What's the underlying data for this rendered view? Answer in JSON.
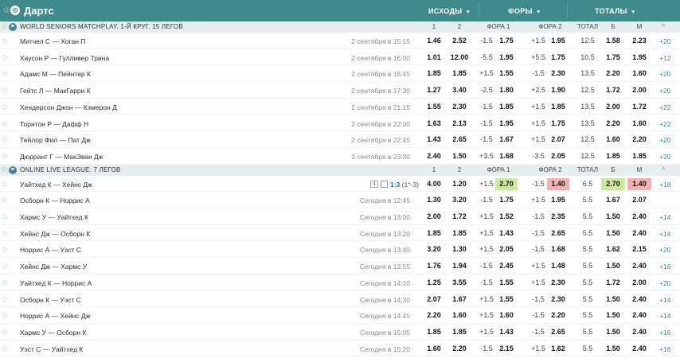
{
  "header": {
    "title": "Дартс",
    "groups": [
      "ИСХОДЫ",
      "ФОРЫ",
      "ТОТАЛЫ"
    ]
  },
  "leagues": [
    {
      "name": "WORLD SENIORS MATCHPLAY. 1-Й КРУГ. 15 ЛЕГОВ",
      "cols": [
        "1",
        "2",
        "ФОРА 1",
        "ФОРА 2",
        "ТОТАЛ",
        "Б",
        "М"
      ],
      "matches": [
        {
          "name": "Митчел С — Хоган П",
          "time": "2 сентября в 15:15",
          "o1": "1.46",
          "o2": "2.52",
          "h1": "-1.5",
          "h1o": "1.75",
          "h2": "+1.5",
          "h2o": "1.95",
          "t": "12.5",
          "b": "1.58",
          "m": "2.23",
          "more": "+20"
        },
        {
          "name": "Хаусон Р — Гулливер Трина",
          "time": "2 сентября в 16:00",
          "o1": "1.01",
          "o2": "12.00",
          "h1": "-5.5",
          "h1o": "1.95",
          "h2": "+5.5",
          "h2o": "1.75",
          "t": "10.5",
          "b": "1.75",
          "m": "1.95",
          "more": "+12"
        },
        {
          "name": "Адамс М — Пейнтер К",
          "time": "2 сентября в 16:45",
          "o1": "1.85",
          "o2": "1.85",
          "h1": "+1.5",
          "h1o": "1.55",
          "h2": "-1.5",
          "h2o": "2.30",
          "t": "13.5",
          "b": "2.20",
          "m": "1.60",
          "more": "+20"
        },
        {
          "name": "Гейтс Л — МакГарри К",
          "time": "2 сентября в 17:30",
          "o1": "1.27",
          "o2": "3.40",
          "h1": "-2.5",
          "h1o": "1.80",
          "h2": "+2.5",
          "h2o": "1.90",
          "t": "12.5",
          "b": "1.72",
          "m": "2.00",
          "more": "+20"
        },
        {
          "name": "Хендерсон Джон — Кэмерон Д",
          "time": "2 сентября в 21:15",
          "o1": "1.55",
          "o2": "2.30",
          "h1": "-1.5",
          "h1o": "1.85",
          "h2": "+1.5",
          "h2o": "1.85",
          "t": "13.5",
          "b": "2.00",
          "m": "1.72",
          "more": "+22"
        },
        {
          "name": "Торнтон Р — Дафф Н",
          "time": "2 сентября в 22:00",
          "o1": "1.63",
          "o2": "2.13",
          "h1": "-1.5",
          "h1o": "1.95",
          "h2": "+1.5",
          "h2o": "1.75",
          "t": "13.5",
          "b": "2.20",
          "m": "1.60",
          "more": "+22"
        },
        {
          "name": "Тейлор Фил — Пат Дж",
          "time": "2 сентября в 22:45",
          "o1": "1.43",
          "o2": "2.65",
          "h1": "-1.5",
          "h1o": "1.67",
          "h2": "+1.5",
          "h2o": "2.07",
          "t": "12.5",
          "b": "1.60",
          "m": "2.20",
          "more": "+20"
        },
        {
          "name": "Дюррант Г — МакЭван Дж",
          "time": "2 сентября в 23:30",
          "o1": "2.40",
          "o2": "1.50",
          "h1": "+3.5",
          "h1o": "1.68",
          "h2": "-3.5",
          "h2o": "2.05",
          "t": "12.5",
          "b": "1.85",
          "m": "1.85",
          "more": "+20"
        }
      ]
    },
    {
      "name": "ONLINE LIVE LEAGUE. 7 ЛЕГОВ",
      "cols": [
        "1",
        "2",
        "ФОРА 1",
        "ФОРА 2",
        "ТОТАЛ",
        "Б",
        "М"
      ],
      "matches": [
        {
          "name": "Уайтхед К — Хейнс Дж",
          "time": "",
          "live": "4",
          "score": "1:3",
          "score_detail": "(1*-3)",
          "o1": "4.00",
          "o2": "1.20",
          "h1": "+1.5",
          "h1o": "2.70",
          "h2": "-1.5",
          "h2o": "1.40",
          "t": "6.5",
          "b": "2.70",
          "m": "1.40",
          "more": "+18"
        },
        {
          "name": "Осборн К — Норрис А",
          "time": "Сегодня в 12:45",
          "o1": "1.30",
          "o2": "3.20",
          "h1": "-1.5",
          "h1o": "1.75",
          "h2": "+1.5",
          "h2o": "1.95",
          "t": "5.5",
          "b": "1.67",
          "m": "2.07",
          "more": ""
        },
        {
          "name": "Хармс У — Уайтхед К",
          "time": "Сегодня в 13:00",
          "o1": "2.00",
          "o2": "1.72",
          "h1": "+1.5",
          "h1o": "1.52",
          "h2": "-1.5",
          "h2o": "2.35",
          "t": "5.5",
          "b": "1.50",
          "m": "2.40",
          "more": "+14"
        },
        {
          "name": "Хейнс Дж — Осборн К",
          "time": "Сегодня в 13:20",
          "o1": "1.85",
          "o2": "1.85",
          "h1": "+1.5",
          "h1o": "1.43",
          "h2": "-1.5",
          "h2o": "2.65",
          "t": "5.5",
          "b": "1.50",
          "m": "2.40",
          "more": "+14"
        },
        {
          "name": "Норрис А — Уэст С",
          "time": "Сегодня в 13:40",
          "o1": "3.20",
          "o2": "1.30",
          "h1": "+1.5",
          "h1o": "2.05",
          "h2": "-1.5",
          "h2o": "1.68",
          "t": "5.5",
          "b": "1.62",
          "m": "2.15",
          "more": "+20"
        },
        {
          "name": "Хейнс Дж — Хармс У",
          "time": "Сегодня в 13:55",
          "o1": "1.76",
          "o2": "1.94",
          "h1": "-1.5",
          "h1o": "2.45",
          "h2": "+1.5",
          "h2o": "1.48",
          "t": "5.5",
          "b": "1.50",
          "m": "2.40",
          "more": "+16"
        },
        {
          "name": "Уайтхед К — Норрис А",
          "time": "Сегодня в 14:10",
          "o1": "1.25",
          "o2": "3.55",
          "h1": "-1.5",
          "h1o": "1.55",
          "h2": "+1.5",
          "h2o": "2.30",
          "t": "5.5",
          "b": "1.72",
          "m": "2.00",
          "more": "+20"
        },
        {
          "name": "Осборн К — Уэст С",
          "time": "Сегодня в 14:30",
          "o1": "2.07",
          "o2": "1.67",
          "h1": "+1.5",
          "h1o": "1.55",
          "h2": "-1.5",
          "h2o": "2.30",
          "t": "5.5",
          "b": "1.50",
          "m": "2.40",
          "more": "+14"
        },
        {
          "name": "Норрис А — Хейнс Дж",
          "time": "Сегодня в 14:45",
          "o1": "2.20",
          "o2": "1.60",
          "h1": "+1.5",
          "h1o": "1.60",
          "h2": "-1.5",
          "h2o": "2.20",
          "t": "5.5",
          "b": "1.50",
          "m": "2.40",
          "more": "+14"
        },
        {
          "name": "Хармс У — Осборн К",
          "time": "Сегодня в 15:05",
          "o1": "1.85",
          "o2": "1.85",
          "h1": "+1.5",
          "h1o": "1.43",
          "h2": "-1.5",
          "h2o": "2.65",
          "t": "5.5",
          "b": "1.50",
          "m": "2.40",
          "more": "+16"
        },
        {
          "name": "Уэст С — Уайтхед К",
          "time": "Сегодня в 15:20",
          "o1": "1.60",
          "o2": "2.20",
          "h1": "-1.5",
          "h1o": "2.15",
          "h2": "+1.5",
          "h2o": "1.62",
          "t": "5.5",
          "b": "1.50",
          "m": "2.40",
          "more": "+16"
        }
      ]
    }
  ]
}
